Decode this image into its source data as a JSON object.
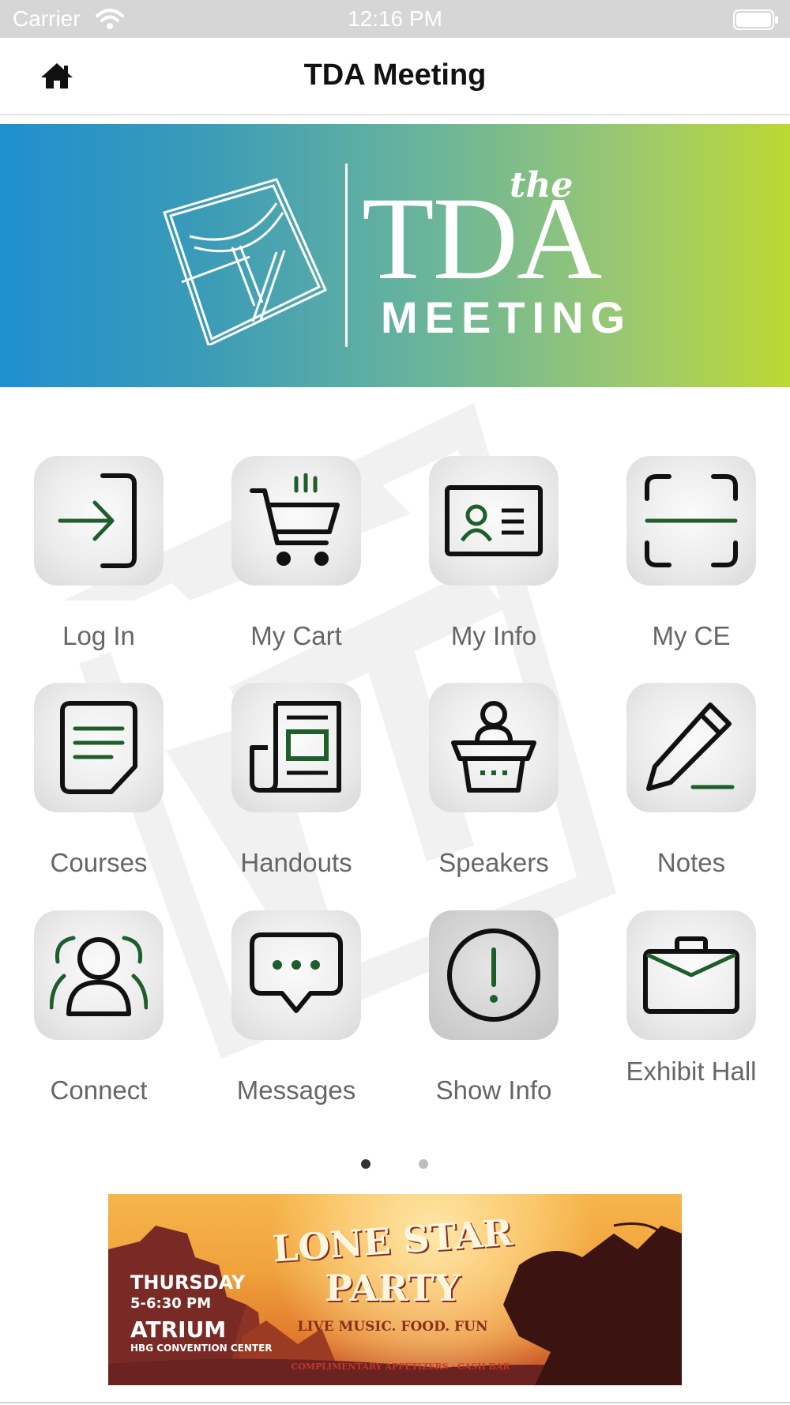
{
  "status_bar": {
    "carrier": "Carrier",
    "time": "12:16 PM"
  },
  "nav": {
    "title": "TDA Meeting",
    "home_icon": "home-icon"
  },
  "banner": {
    "the": "the",
    "tda": "TDA",
    "meeting": "MEETING",
    "gradient": [
      "#1f8fcf",
      "#6bb59a",
      "#bcd832"
    ]
  },
  "grid": {
    "items": [
      {
        "label": "Log In",
        "icon": "log-in-icon"
      },
      {
        "label": "My Cart",
        "icon": "cart-icon"
      },
      {
        "label": "My Info",
        "icon": "id-card-icon"
      },
      {
        "label": "My CE",
        "icon": "scan-icon"
      },
      {
        "label": "Courses",
        "icon": "document-icon"
      },
      {
        "label": "Handouts",
        "icon": "newspaper-icon"
      },
      {
        "label": "Speakers",
        "icon": "podium-icon"
      },
      {
        "label": "Notes",
        "icon": "pencil-icon"
      },
      {
        "label": "Connect",
        "icon": "people-icon"
      },
      {
        "label": "Messages",
        "icon": "chat-icon"
      },
      {
        "label": "Show Info",
        "icon": "info-exclamation-icon"
      },
      {
        "label": "Exhibit Hall",
        "icon": "briefcase-icon"
      }
    ]
  },
  "pager": {
    "pages": 2,
    "current": 1
  },
  "ad": {
    "title_line1": "LONE STAR",
    "title_line2": "PARTY",
    "tagline": "LIVE MUSIC. FOOD. FUN",
    "day": "THURSDAY",
    "time": "5-6:30 PM",
    "place": "ATRIUM",
    "venue": "HBG CONVENTION CENTER",
    "footer": "COMPLIMENTARY APPETIZERS · CASH BAR"
  },
  "colors": {
    "accent_green": "#1e5e2a",
    "icon_dark": "#111111",
    "label_gray": "#666666"
  }
}
